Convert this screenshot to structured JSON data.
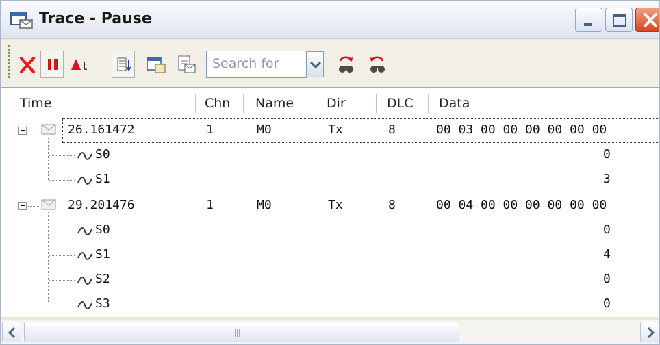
{
  "window": {
    "title": "Trace - Pause",
    "controls": [
      "minimize-icon",
      "maximize-icon",
      "close-icon"
    ]
  },
  "toolbar": {
    "buttons": [
      "clear-icon",
      "pause-icon",
      "trigger-icon",
      "filter-icon",
      "window-icon",
      "copy-icon",
      "find-next-icon",
      "find-previous-icon"
    ],
    "search": {
      "placeholder": "Search for",
      "value": ""
    },
    "accent_colors": {
      "clear": "#e0201b",
      "pause": "#d4141c"
    }
  },
  "columns": {
    "time": "Time",
    "chn": "Chn",
    "name": "Name",
    "dir": "Dir",
    "dlc": "DLC",
    "data": "Data"
  },
  "rows": [
    {
      "type": "message",
      "time": "26.161472",
      "chn": "1",
      "name": "M0",
      "dir": "Tx",
      "dlc": "8",
      "data": "00 03 00 00 00 00 00 00",
      "expanded": true,
      "selected": true
    },
    {
      "type": "signal",
      "name": "S0",
      "value": "0"
    },
    {
      "type": "signal",
      "name": "S1",
      "value": "3"
    },
    {
      "type": "message",
      "time": "29.201476",
      "chn": "1",
      "name": "M0",
      "dir": "Tx",
      "dlc": "8",
      "data": "00 04 00 00 00 00 00 00",
      "expanded": true,
      "selected": false
    },
    {
      "type": "signal",
      "name": "S0",
      "value": "0"
    },
    {
      "type": "signal",
      "name": "S1",
      "value": "4"
    },
    {
      "type": "signal",
      "name": "S2",
      "value": "0"
    },
    {
      "type": "signal",
      "name": "S3",
      "value": "0"
    }
  ]
}
